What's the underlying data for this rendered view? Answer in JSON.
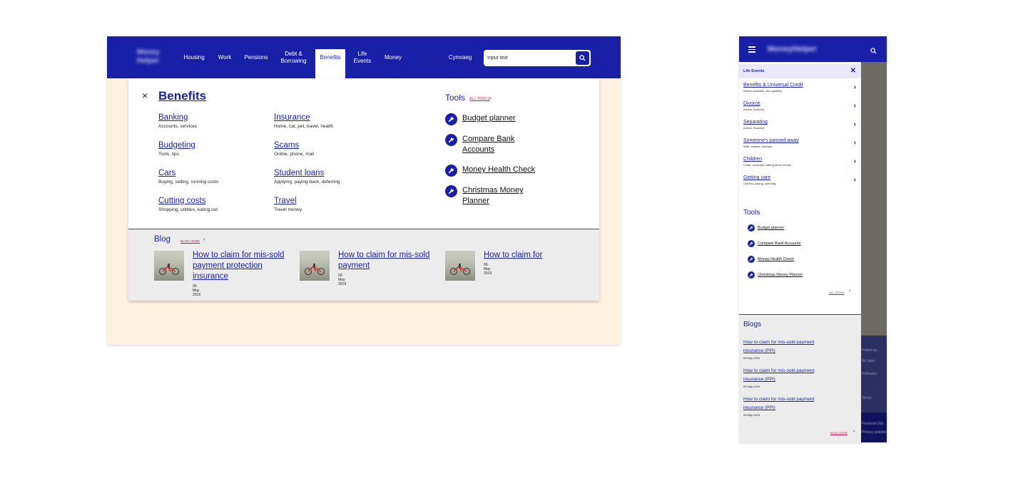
{
  "desktop": {
    "logo_text": "Money Helper",
    "nav": [
      {
        "label": "Housing"
      },
      {
        "label": "Work"
      },
      {
        "label": "Pensions"
      },
      {
        "label": "Debt &",
        "label2": "Borrowing"
      },
      {
        "label": "Benefits"
      },
      {
        "label": "Life",
        "label2": "Events"
      },
      {
        "label": "Money"
      }
    ],
    "language_link": "Cymraeg",
    "search": {
      "value": "Input text"
    },
    "menu": {
      "close": "×",
      "title": "Benefits",
      "categories": [
        {
          "label": "Banking",
          "desc": "Accounts, services"
        },
        {
          "label": "Budgeting",
          "desc": "Tools, tips"
        },
        {
          "label": "Cars",
          "desc": "Buying, selling, running costs"
        },
        {
          "label": "Cutting costs",
          "desc": "Shopping, utilities, eating out"
        },
        {
          "label": "Insurance",
          "desc": "Home, car, pet, travel, health"
        },
        {
          "label": "Scams",
          "desc": "Online, phone, mail"
        },
        {
          "label": "Student loans",
          "desc": "Applying, paying back, deferring"
        },
        {
          "label": "Travel",
          "desc": "Travel money"
        }
      ],
      "tools_heading": "Tools",
      "all_tools": "ALL TOOLS",
      "tools": [
        {
          "line1": "Budget planner",
          "line2": ""
        },
        {
          "line1": "Compare Bank",
          "line2": "Accounts"
        },
        {
          "line1": "Money Health Check",
          "line2": ""
        },
        {
          "line1": "Christmas Money",
          "line2": "Planner"
        }
      ],
      "blog_heading": "Blog",
      "blog_home": "BLOG HOME",
      "blogs": [
        {
          "title": "How to claim for mis-sold payment protection insurance",
          "date": "09 May 2019"
        },
        {
          "title": "How to claim for mis-sold payment",
          "date": "09 May 2019"
        },
        {
          "title": "How to claim for",
          "date": "09 May 2019"
        }
      ]
    }
  },
  "mobile": {
    "logo_text": "MoneyHelper",
    "section_title": "Life Events",
    "section_close": "✕",
    "items": [
      {
        "label": "Benefits & Universal Credit",
        "desc": "What's available, who qualifies"
      },
      {
        "label": "Divorce",
        "desc": "Advice, finances"
      },
      {
        "label": "Separating",
        "desc": "Advice, finances"
      },
      {
        "label": "Someone's passed away",
        "desc": "Wills, estates, funerals"
      },
      {
        "label": "Children",
        "desc": "Costs, university, talking about money"
      },
      {
        "label": "Getting care",
        "desc": "Options, paying, planning"
      }
    ],
    "tools_heading": "Tools",
    "tools": [
      "Budget planner",
      "Compare Bank Accounts",
      "Money Health Check",
      "Christmas Money Planner"
    ],
    "all_tools": "ALL TOOLS",
    "blogs_heading": "Blogs",
    "blogs": [
      {
        "line1": "How to claim for mis-sold payment",
        "line2": "insurance (PPI)",
        "date": "09 May 2019"
      },
      {
        "line1": "How to claim for mis-sold payment",
        "line2": "insurance (PPI)",
        "date": "09 May 2019"
      },
      {
        "line1": "How to claim for mis-sold payment",
        "line2": "insurance (PPI)",
        "date": "09 May 2019"
      }
    ],
    "blog_home": "BLOG HOME",
    "background_texts": [
      "Follow us:",
      "3k Likes",
      "Followers",
      "Terms",
      "Financial Gds",
      "Privacy policies"
    ]
  },
  "colors": {
    "brand": "#1a1fa8",
    "accent": "#c2185b",
    "desktop_bg": "#fdf2e2"
  },
  "icons": [
    "search-icon",
    "close-icon",
    "wrench-icon",
    "chevron-right-icon",
    "hamburger-menu-icon"
  ]
}
